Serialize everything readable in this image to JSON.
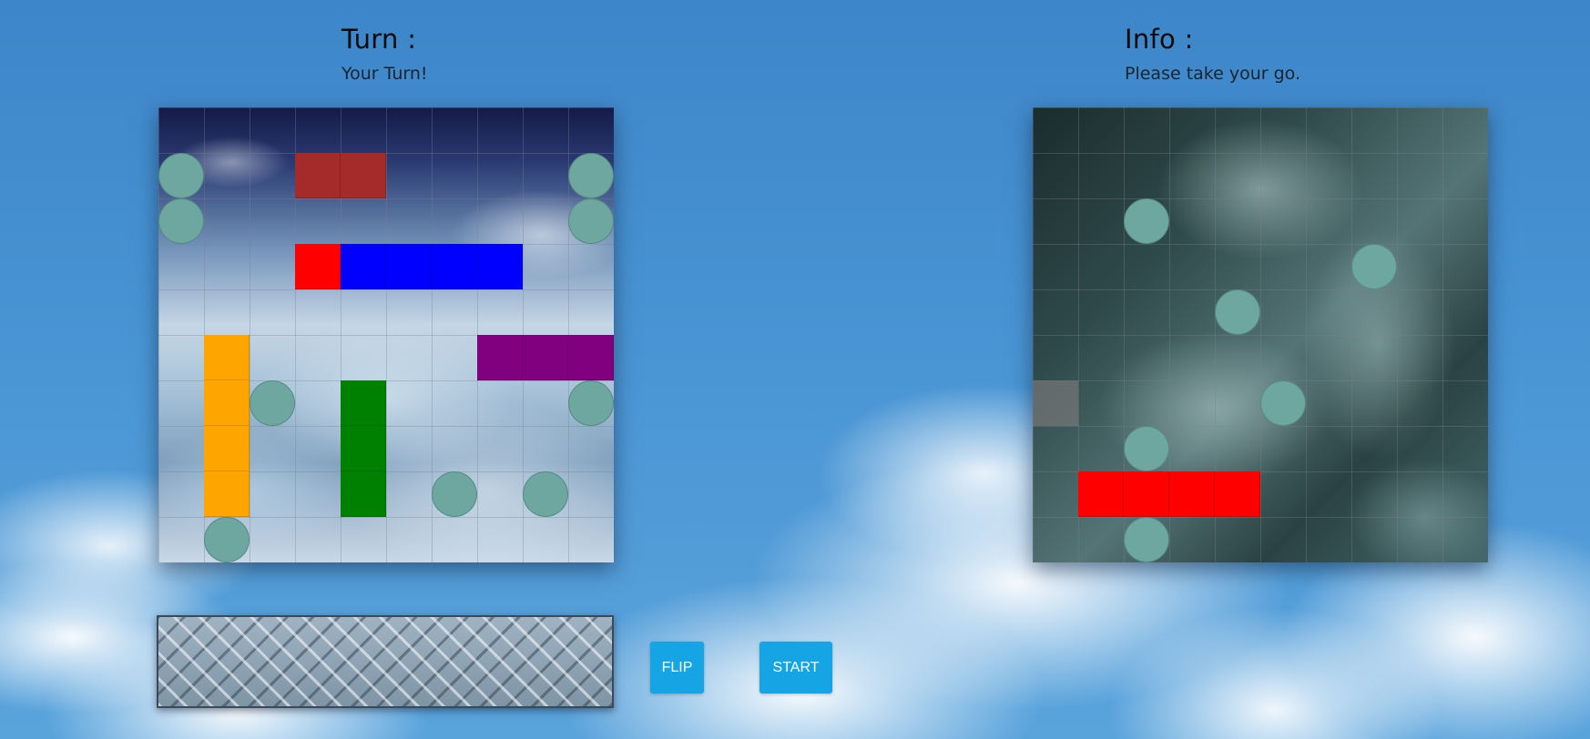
{
  "turn": {
    "title": "Turn :",
    "status": "Your Turn!"
  },
  "info": {
    "title": "Info :",
    "message": "Please take your go."
  },
  "player_board": {
    "grid_size": 10,
    "ships": [
      {
        "color": "#a52a2a",
        "row": 1,
        "col": 3,
        "length": 2,
        "orientation": "horizontal",
        "hit_segments": []
      },
      {
        "color": "#0000ff",
        "row": 3,
        "col": 3,
        "length": 5,
        "orientation": "horizontal",
        "hit_segments": [
          0
        ],
        "hit_color": "#ff0000"
      },
      {
        "color": "#ffa500",
        "row": 5,
        "col": 1,
        "length": 4,
        "orientation": "vertical",
        "hit_segments": []
      },
      {
        "color": "#800080",
        "row": 5,
        "col": 7,
        "length": 3,
        "orientation": "horizontal",
        "hit_segments": []
      },
      {
        "color": "#008000",
        "row": 6,
        "col": 4,
        "length": 3,
        "orientation": "vertical",
        "hit_segments": []
      }
    ],
    "misses": [
      [
        1,
        0
      ],
      [
        2,
        0
      ],
      [
        1,
        9
      ],
      [
        2,
        9
      ],
      [
        6,
        2
      ],
      [
        6,
        9
      ],
      [
        8,
        6
      ],
      [
        8,
        8
      ],
      [
        9,
        1
      ]
    ]
  },
  "enemy_board": {
    "grid_size": 10,
    "sunk_ships": [
      {
        "color": "#ff0000",
        "row": 8,
        "col": 1,
        "length": 4,
        "orientation": "horizontal"
      }
    ],
    "misses": [
      [
        2,
        2
      ],
      [
        3,
        7
      ],
      [
        4,
        4
      ],
      [
        6,
        5
      ],
      [
        7,
        2
      ],
      [
        9,
        2
      ]
    ],
    "hover_cell": [
      6,
      0
    ]
  },
  "controls": {
    "flip_label": "FLIP",
    "start_label": "START"
  },
  "colors": {
    "peg": "#6ea6a0",
    "button": "#15a4e4"
  }
}
